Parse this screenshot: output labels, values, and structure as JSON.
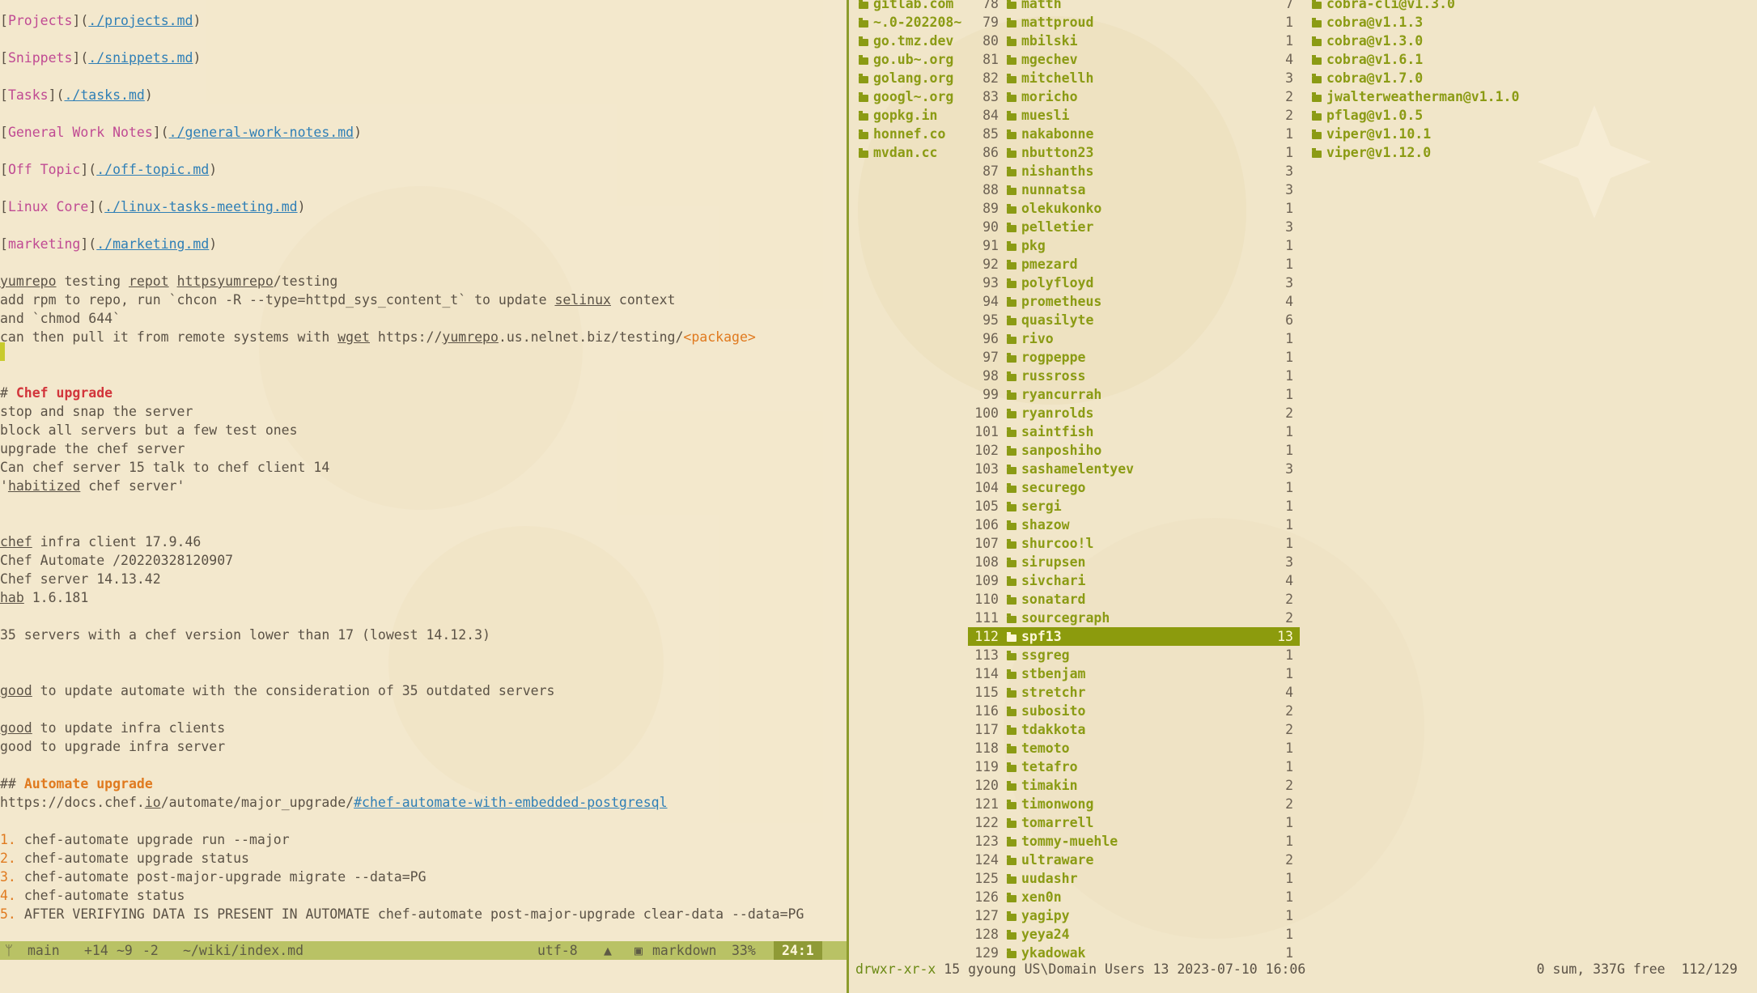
{
  "editor": {
    "lines": [
      {
        "parts": [
          {
            "t": "[",
            "c": ""
          },
          {
            "t": "Projects",
            "c": "pink"
          },
          {
            "t": "](",
            "c": ""
          },
          {
            "t": "./projects.md",
            "c": "link"
          },
          {
            "t": ")",
            "c": ""
          }
        ]
      },
      {
        "parts": [
          {
            "t": "[",
            "c": ""
          },
          {
            "t": "Snippets",
            "c": "pink"
          },
          {
            "t": "](",
            "c": ""
          },
          {
            "t": "./snippets.md",
            "c": "link"
          },
          {
            "t": ")",
            "c": ""
          }
        ]
      },
      {
        "parts": [
          {
            "t": "[",
            "c": ""
          },
          {
            "t": "Tasks",
            "c": "pink"
          },
          {
            "t": "](",
            "c": ""
          },
          {
            "t": "./tasks.md",
            "c": "link"
          },
          {
            "t": ")",
            "c": ""
          }
        ]
      },
      {
        "parts": [
          {
            "t": "[",
            "c": ""
          },
          {
            "t": "General Work Notes",
            "c": "pink"
          },
          {
            "t": "](",
            "c": ""
          },
          {
            "t": "./general-work-notes.md",
            "c": "link"
          },
          {
            "t": ")",
            "c": ""
          }
        ]
      },
      {
        "parts": [
          {
            "t": "[",
            "c": ""
          },
          {
            "t": "Off Topic",
            "c": "pink"
          },
          {
            "t": "](",
            "c": ""
          },
          {
            "t": "./off-topic.md",
            "c": "link"
          },
          {
            "t": ")",
            "c": ""
          }
        ]
      },
      {
        "parts": [
          {
            "t": "[",
            "c": ""
          },
          {
            "t": "Linux Core",
            "c": "pink"
          },
          {
            "t": "](",
            "c": ""
          },
          {
            "t": "./linux-tasks-meeting.md",
            "c": "link"
          },
          {
            "t": ")",
            "c": ""
          }
        ]
      },
      {
        "parts": [
          {
            "t": "[",
            "c": ""
          },
          {
            "t": "marketing",
            "c": "pink"
          },
          {
            "t": "](",
            "c": ""
          },
          {
            "t": "./marketing.md",
            "c": "link"
          },
          {
            "t": ")",
            "c": ""
          }
        ]
      },
      {
        "parts": [
          {
            "t": "yumrepo",
            "c": "ul"
          },
          {
            "t": " testing ",
            "c": ""
          },
          {
            "t": "repot",
            "c": "ul"
          },
          {
            "t": " ",
            "c": ""
          },
          {
            "t": "httpsyumrepo",
            "c": "ul"
          },
          {
            "t": "/testing",
            "c": ""
          }
        ]
      },
      {
        "parts": [
          {
            "t": "add rpm to repo, run `chcon -R --type=httpd_sys_content_t` to update ",
            "c": ""
          },
          {
            "t": "selinux",
            "c": "ul"
          },
          {
            "t": " context",
            "c": ""
          }
        ]
      },
      {
        "parts": [
          {
            "t": "and `chmod 644`",
            "c": ""
          }
        ]
      },
      {
        "parts": [
          {
            "t": "can then pull it from remote systems with ",
            "c": ""
          },
          {
            "t": "wget",
            "c": "ul"
          },
          {
            "t": " https://",
            "c": ""
          },
          {
            "t": "yumrepo",
            "c": "ul"
          },
          {
            "t": ".us.nelnet.biz/testing/",
            "c": ""
          },
          {
            "t": "<package>",
            "c": "orange"
          }
        ]
      },
      {
        "parts": [
          {
            "t": "# ",
            "c": ""
          },
          {
            "t": "Chef upgrade",
            "c": "red"
          }
        ]
      },
      {
        "parts": [
          {
            "t": "stop and snap the server",
            "c": ""
          }
        ]
      },
      {
        "parts": [
          {
            "t": "block all servers but a few test ones",
            "c": ""
          }
        ]
      },
      {
        "parts": [
          {
            "t": "upgrade the chef server",
            "c": ""
          }
        ]
      },
      {
        "parts": [
          {
            "t": "Can chef server 15 talk to chef client 14",
            "c": ""
          }
        ]
      },
      {
        "parts": [
          {
            "t": "'",
            "c": ""
          },
          {
            "t": "habitized",
            "c": "ul"
          },
          {
            "t": " chef server'",
            "c": ""
          }
        ]
      },
      {
        "parts": [
          {
            "t": "chef",
            "c": "ul"
          },
          {
            "t": " infra client 17.9.46",
            "c": ""
          }
        ]
      },
      {
        "parts": [
          {
            "t": "Chef Automate /20220328120907",
            "c": ""
          }
        ]
      },
      {
        "parts": [
          {
            "t": "Chef server 14.13.42",
            "c": ""
          }
        ]
      },
      {
        "parts": [
          {
            "t": "hab",
            "c": "ul"
          },
          {
            "t": " 1.6.181",
            "c": ""
          }
        ]
      },
      {
        "parts": [
          {
            "t": "35 servers with a chef version lower than 17 (lowest 14.12.3)",
            "c": ""
          }
        ]
      },
      {
        "parts": [
          {
            "t": "good",
            "c": "ul"
          },
          {
            "t": " to update automate with the consideration of 35 outdated servers",
            "c": ""
          }
        ]
      },
      {
        "parts": [
          {
            "t": "good",
            "c": "ul"
          },
          {
            "t": " to update infra clients",
            "c": ""
          }
        ]
      },
      {
        "parts": [
          {
            "t": "good to upgrade infra server",
            "c": ""
          }
        ]
      },
      {
        "parts": [
          {
            "t": "## ",
            "c": ""
          },
          {
            "t": "Automate upgrade",
            "c": "orangeb"
          }
        ]
      },
      {
        "parts": [
          {
            "t": "https://docs.chef.",
            "c": ""
          },
          {
            "t": "io",
            "c": "ul"
          },
          {
            "t": "/automate/major_upgrade/",
            "c": ""
          },
          {
            "t": "#chef-automate-with-embedded-postgresql",
            "c": "link"
          }
        ]
      },
      {
        "parts": [
          {
            "t": "1. ",
            "c": "orange"
          },
          {
            "t": "chef-automate upgrade run --major",
            "c": ""
          }
        ]
      },
      {
        "parts": [
          {
            "t": "2. ",
            "c": "orange"
          },
          {
            "t": "chef-automate upgrade status",
            "c": ""
          }
        ]
      },
      {
        "parts": [
          {
            "t": "3. ",
            "c": "orange"
          },
          {
            "t": "chef-automate post-major-upgrade migrate --data=PG",
            "c": ""
          }
        ]
      },
      {
        "parts": [
          {
            "t": "4. ",
            "c": "orange"
          },
          {
            "t": "chef-automate status",
            "c": ""
          }
        ]
      },
      {
        "parts": [
          {
            "t": "5. ",
            "c": "orange"
          },
          {
            "t": "AFTER VERIFYING DATA IS PRESENT IN AUTOMATE chef-automate post-major-upgrade clear-data --data=PG",
            "c": ""
          }
        ]
      }
    ],
    "statusline": {
      "branch_icon": "git-branch-icon",
      "branch": "main",
      "diff_added": "+14",
      "diff_changed": "~9",
      "diff_removed": "-2",
      "file": "~/wiki/index.md",
      "encoding": "utf-8",
      "os_icon": "penguin-icon",
      "filetype_icon": "markdown-icon",
      "filetype": "markdown",
      "percent": "33%",
      "position": "24:1"
    }
  },
  "ranger": {
    "left_col": [
      "gitlab.com",
      "~.0-202208~",
      "go.tmz.dev",
      "go.ub~.org",
      "golang.org",
      "googl~.org",
      "gopkg.in",
      "honnef.co",
      "mvdan.cc"
    ],
    "middle_col": [
      {
        "n": "78",
        "name": "matth",
        "count": "7"
      },
      {
        "n": "79",
        "name": "mattproud",
        "count": "1"
      },
      {
        "n": "80",
        "name": "mbilski",
        "count": "1"
      },
      {
        "n": "81",
        "name": "mgechev",
        "count": "4"
      },
      {
        "n": "82",
        "name": "mitchellh",
        "count": "3"
      },
      {
        "n": "83",
        "name": "moricho",
        "count": "2"
      },
      {
        "n": "84",
        "name": "muesli",
        "count": "2"
      },
      {
        "n": "85",
        "name": "nakabonne",
        "count": "1"
      },
      {
        "n": "86",
        "name": "nbutton23",
        "count": "1"
      },
      {
        "n": "87",
        "name": "nishanths",
        "count": "3"
      },
      {
        "n": "88",
        "name": "nunnatsa",
        "count": "3"
      },
      {
        "n": "89",
        "name": "olekukonko",
        "count": "1"
      },
      {
        "n": "90",
        "name": "pelletier",
        "count": "3"
      },
      {
        "n": "91",
        "name": "pkg",
        "count": "1"
      },
      {
        "n": "92",
        "name": "pmezard",
        "count": "1"
      },
      {
        "n": "93",
        "name": "polyfloyd",
        "count": "3"
      },
      {
        "n": "94",
        "name": "prometheus",
        "count": "4"
      },
      {
        "n": "95",
        "name": "quasilyte",
        "count": "6"
      },
      {
        "n": "96",
        "name": "rivo",
        "count": "1"
      },
      {
        "n": "97",
        "name": "rogpeppe",
        "count": "1"
      },
      {
        "n": "98",
        "name": "russross",
        "count": "1"
      },
      {
        "n": "99",
        "name": "ryancurrah",
        "count": "1"
      },
      {
        "n": "100",
        "name": "ryanrolds",
        "count": "2"
      },
      {
        "n": "101",
        "name": "saintfish",
        "count": "1"
      },
      {
        "n": "102",
        "name": "sanposhiho",
        "count": "1"
      },
      {
        "n": "103",
        "name": "sashamelentyev",
        "count": "3"
      },
      {
        "n": "104",
        "name": "securego",
        "count": "1"
      },
      {
        "n": "105",
        "name": "sergi",
        "count": "1"
      },
      {
        "n": "106",
        "name": "shazow",
        "count": "1"
      },
      {
        "n": "107",
        "name": "shurcoo!l",
        "count": "1"
      },
      {
        "n": "108",
        "name": "sirupsen",
        "count": "3"
      },
      {
        "n": "109",
        "name": "sivchari",
        "count": "4"
      },
      {
        "n": "110",
        "name": "sonatard",
        "count": "2"
      },
      {
        "n": "111",
        "name": "sourcegraph",
        "count": "2"
      },
      {
        "n": "112",
        "name": "spf13",
        "count": "13",
        "selected": true
      },
      {
        "n": "113",
        "name": "ssgreg",
        "count": "1"
      },
      {
        "n": "114",
        "name": "stbenjam",
        "count": "1"
      },
      {
        "n": "115",
        "name": "stretchr",
        "count": "4"
      },
      {
        "n": "116",
        "name": "subosito",
        "count": "2"
      },
      {
        "n": "117",
        "name": "tdakkota",
        "count": "2"
      },
      {
        "n": "118",
        "name": "temoto",
        "count": "1"
      },
      {
        "n": "119",
        "name": "tetafro",
        "count": "1"
      },
      {
        "n": "120",
        "name": "timakin",
        "count": "2"
      },
      {
        "n": "121",
        "name": "timonwong",
        "count": "2"
      },
      {
        "n": "122",
        "name": "tomarrell",
        "count": "1"
      },
      {
        "n": "123",
        "name": "tommy-muehle",
        "count": "1"
      },
      {
        "n": "124",
        "name": "ultraware",
        "count": "2"
      },
      {
        "n": "125",
        "name": "uudashr",
        "count": "1"
      },
      {
        "n": "126",
        "name": "xen0n",
        "count": "1"
      },
      {
        "n": "127",
        "name": "yagipy",
        "count": "1"
      },
      {
        "n": "128",
        "name": "yeya24",
        "count": "1"
      },
      {
        "n": "129",
        "name": "ykadowak",
        "count": "1"
      }
    ],
    "right_col": [
      "cobra-cli@v1.3.0",
      "cobra@v1.1.3",
      "cobra@v1.3.0",
      "cobra@v1.6.1",
      "cobra@v1.7.0",
      "jwalterweatherman@v1.1.0",
      "pflag@v1.0.5",
      "viper@v1.10.1",
      "viper@v1.12.0"
    ],
    "status": {
      "perms": "drwxr-xr-x",
      "info": " 15 gyoung US\\Domain Users 13 2023-07-10 16:06",
      "right": "0 sum, 337G free  112/129"
    }
  },
  "colors": {
    "accent": "#8c9b0d",
    "link": "#2f7fb6",
    "heading": "#d2353b",
    "bracket_text": "#c04a93"
  }
}
